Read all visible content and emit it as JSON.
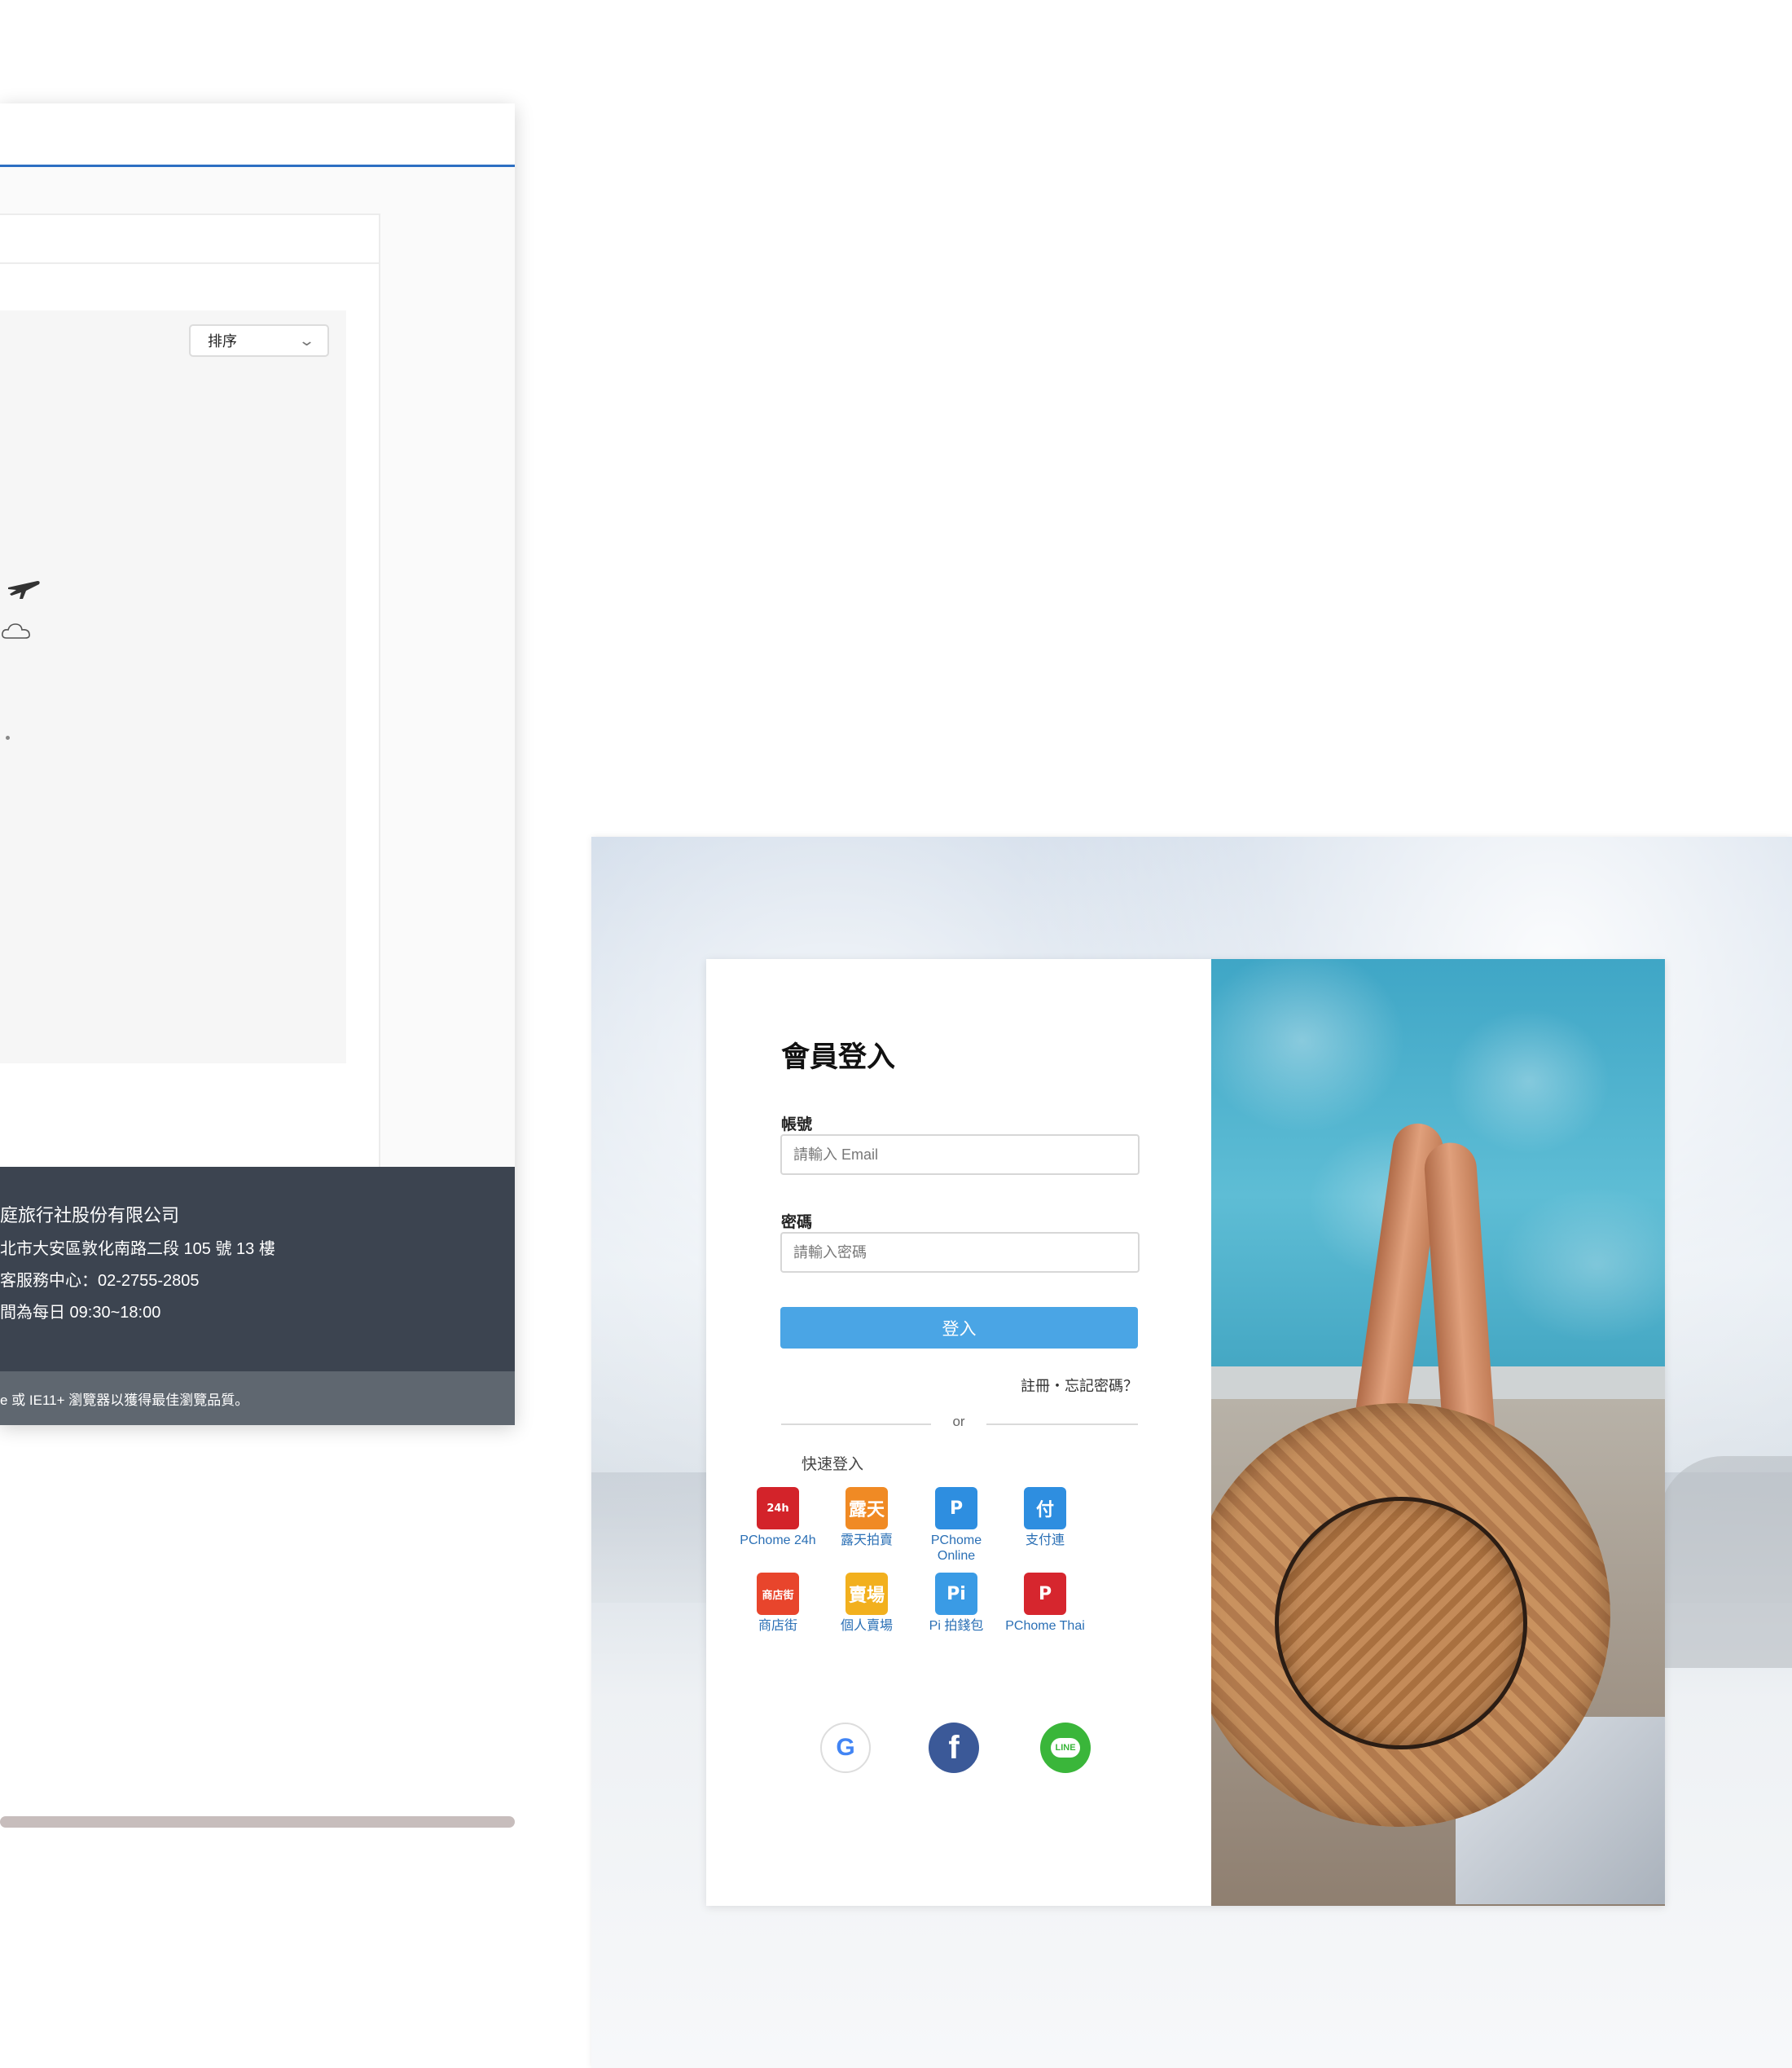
{
  "left_window": {
    "sort_label": "排序",
    "footer": {
      "company": "庭旅行社股份有限公司",
      "address": "北市大安區敦化南路二段 105 號 13 樓",
      "phone": "客服務中心：02-2755-2805",
      "hours": "間為每日 09:30~18:00",
      "browser_note": "e 或 IE11+ 瀏覽器以獲得最佳瀏覽品質。"
    }
  },
  "login": {
    "title": "會員登入",
    "account_label": "帳號",
    "account_placeholder": "請輸入 Email",
    "password_label": "密碼",
    "password_placeholder": "請輸入密碼",
    "submit_label": "登入",
    "help_links": "註冊・忘記密碼？",
    "or_text": "or",
    "quick_login_label": "快速登入",
    "apps": [
      {
        "label": "PChome 24h",
        "icon": "pchome-24h-icon",
        "color": "#d3232a",
        "glyph": "24h"
      },
      {
        "label": "露天拍賣",
        "icon": "ruten-icon",
        "color": "#f08a24",
        "glyph": "露天"
      },
      {
        "label": "PChome Online",
        "icon": "pchome-online-icon",
        "color": "#2e8ee0",
        "glyph": "P"
      },
      {
        "label": "支付連",
        "icon": "pay-link-icon",
        "color": "#2e8ee0",
        "glyph": "付"
      },
      {
        "label": "商店街",
        "icon": "shopping-street-icon",
        "color": "#e8452c",
        "glyph": "商店街"
      },
      {
        "label": "個人賣場",
        "icon": "personal-store-icon",
        "color": "#f2b01e",
        "glyph": "賣場"
      },
      {
        "label": "Pi 拍錢包",
        "icon": "pi-wallet-icon",
        "color": "#3a9be5",
        "glyph": "Pi"
      },
      {
        "label": "PChome Thai",
        "icon": "pchome-thai-icon",
        "color": "#d6262e",
        "glyph": "P"
      }
    ],
    "social": [
      {
        "name": "google-icon",
        "glyph": "G",
        "color": "#4285f4"
      },
      {
        "name": "facebook-icon",
        "glyph": "f",
        "color": "#3b5998"
      },
      {
        "name": "line-icon",
        "glyph": "LINE",
        "color": "#3ab63a"
      }
    ]
  }
}
